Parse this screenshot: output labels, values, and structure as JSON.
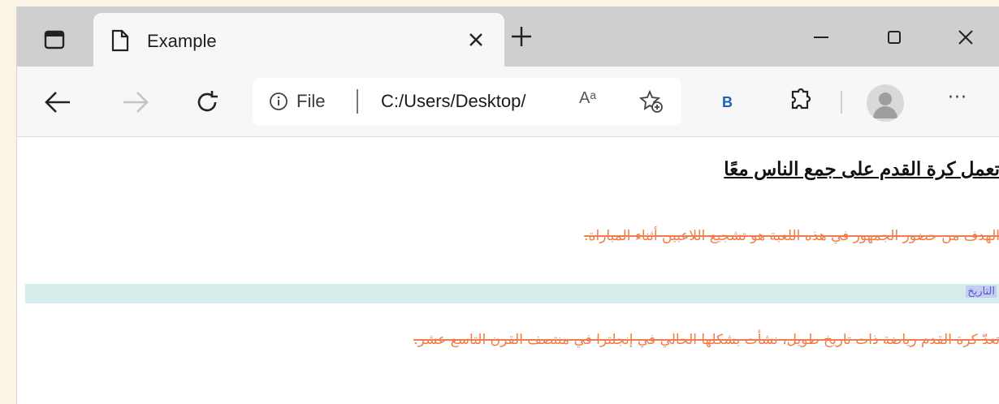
{
  "tab": {
    "title": "Example"
  },
  "toolbar": {
    "address": {
      "scheme_label": "File",
      "url": "C:/Users/Desktop/",
      "read_aloud": "Aᵃ"
    },
    "bing_label": "B",
    "more_label": "···"
  },
  "page": {
    "heading": "تعمل كرة القدم على جمع الناس معًا",
    "paragraph1": "الهدف من حضور الجمهور في هذه اللعبة هو تشجيع اللاعبين أثناء المباراة.",
    "highlight_label": "التاريخ",
    "paragraph2": "تعدّ كرة القدم رياضة ذات تاريخ طويل، نشأت بشكلها الحالي في إنجلترا في منتصف القرن التاسع عشر."
  },
  "colors": {
    "strike_text": "#f07c4a",
    "band": "#d5ecea",
    "highlight": "#c5cdf5"
  }
}
